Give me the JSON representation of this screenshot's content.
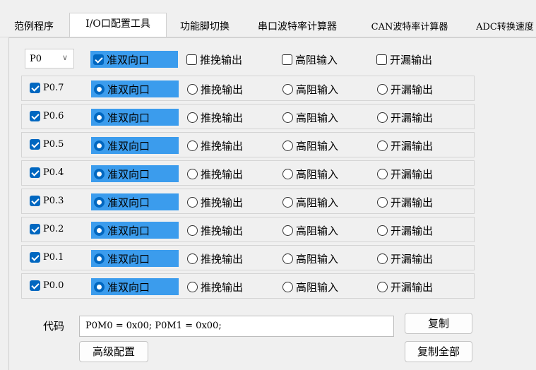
{
  "tabs": [
    {
      "label": "范例程序",
      "active": false
    },
    {
      "label": "I/O口配置工具",
      "active": true
    },
    {
      "label": "功能脚切换",
      "active": false
    },
    {
      "label": "串口波特率计算器",
      "active": false
    },
    {
      "label": "CAN波特率计算器",
      "active": false
    },
    {
      "label": "ADC转换速度",
      "active": false
    }
  ],
  "port_select": {
    "value": "P0",
    "chevron": "chevron-down-icon"
  },
  "header_options": {
    "opt1": "准双向口",
    "opt2": "推挽输出",
    "opt3": "高阻输入",
    "opt4": "开漏输出"
  },
  "pins": [
    {
      "label": "P0.7",
      "checked": true,
      "mode": "准双向口"
    },
    {
      "label": "P0.6",
      "checked": true,
      "mode": "准双向口"
    },
    {
      "label": "P0.5",
      "checked": true,
      "mode": "准双向口"
    },
    {
      "label": "P0.4",
      "checked": true,
      "mode": "准双向口"
    },
    {
      "label": "P0.3",
      "checked": true,
      "mode": "准双向口"
    },
    {
      "label": "P0.2",
      "checked": true,
      "mode": "准双向口"
    },
    {
      "label": "P0.1",
      "checked": true,
      "mode": "准双向口"
    },
    {
      "label": "P0.0",
      "checked": true,
      "mode": "准双向口"
    }
  ],
  "mode_labels": [
    "准双向口",
    "推挽输出",
    "高阻输入",
    "开漏输出"
  ],
  "code": {
    "label": "代码",
    "value": "P0M0 = 0x00; P0M1 = 0x00;"
  },
  "buttons": {
    "copy": "复制",
    "copy_all": "复制全部",
    "advanced": "高级配置"
  },
  "colors": {
    "accent": "#0067c0",
    "selected_bg": "#3b9ced"
  }
}
